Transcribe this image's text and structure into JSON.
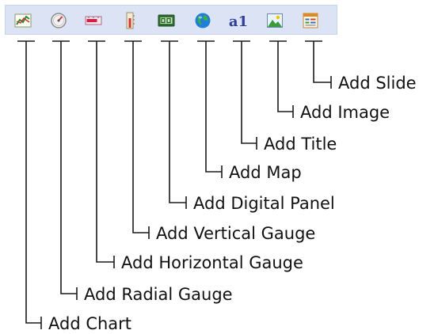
{
  "toolbar": {
    "buttons": [
      {
        "icon": "add-chart-icon",
        "label": "Add Chart"
      },
      {
        "icon": "radial-gauge-icon",
        "label": "Add Radial Gauge"
      },
      {
        "icon": "horizontal-gauge-icon",
        "label": "Add Horizontal Gauge"
      },
      {
        "icon": "vertical-gauge-icon",
        "label": "Add Vertical Gauge"
      },
      {
        "icon": "digital-panel-icon",
        "label": "Add Digital Panel"
      },
      {
        "icon": "map-globe-icon",
        "label": "Add Map"
      },
      {
        "icon": "title-text-icon",
        "label": "Add Title"
      },
      {
        "icon": "image-icon",
        "label": "Add Image"
      },
      {
        "icon": "slide-icon",
        "label": "Add Slide"
      }
    ]
  },
  "icons": {
    "title_glyph": "a1"
  },
  "colors": {
    "toolbar_bg": "#dbe3f5",
    "leader_line": "#1a1a1a"
  }
}
